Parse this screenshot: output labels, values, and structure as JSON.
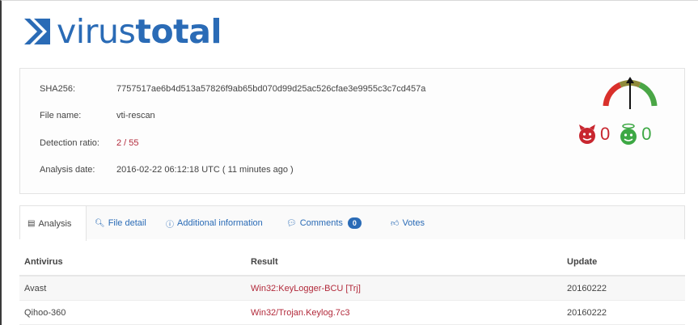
{
  "logo": {
    "text_virus": "virus",
    "text_total": "total",
    "color": "#2a6bb6"
  },
  "file_info": {
    "rows": [
      {
        "label": "SHA256:",
        "value": "7757517ae6b4d513a57826f9ab65bd070d99d25ac526cfae3e9955c3c7cd457a"
      },
      {
        "label": "File name:",
        "value": "vti-rescan"
      },
      {
        "label": "Detection ratio:",
        "value": "2 / 55"
      },
      {
        "label": "Analysis date:",
        "value": "2016-02-22 06:12:18 UTC ( 11 minutes ago )"
      }
    ]
  },
  "votes": {
    "malicious": "0",
    "harmless": "0",
    "malicious_color": "#c8262f",
    "harmless_color": "#3da844"
  },
  "tabs": [
    {
      "label": "Analysis",
      "icon": "table-icon"
    },
    {
      "label": "File detail",
      "icon": "search-icon"
    },
    {
      "label": "Additional information",
      "icon": "info-icon"
    },
    {
      "label": "Comments",
      "icon": "comment-icon",
      "badge": "0"
    },
    {
      "label": "Votes",
      "icon": "thumbs-icon"
    }
  ],
  "results": {
    "headers": [
      "Antivirus",
      "Result",
      "Update"
    ],
    "rows": [
      {
        "antivirus": "Avast",
        "result": "Win32:KeyLogger-BCU [Trj]",
        "update": "20160222"
      },
      {
        "antivirus": "Qihoo-360",
        "result": "Win32/Trojan.Keylog.7c3",
        "update": "20160222"
      }
    ]
  }
}
